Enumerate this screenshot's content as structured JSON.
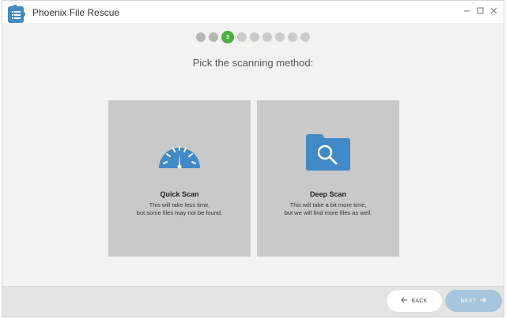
{
  "window": {
    "title": "Phoenix File Rescue",
    "controls": [
      "minimize-icon",
      "maximize-icon",
      "close-icon"
    ]
  },
  "wizard": {
    "steps_total": 9,
    "current_step": 3,
    "current_step_label": "3"
  },
  "main": {
    "heading": "Pick the scanning method:",
    "options": [
      {
        "id": "quick",
        "icon": "speedometer-icon",
        "title": "Quick Scan",
        "desc_line1": "This will take less time,",
        "desc_line2": "but some files may not be found."
      },
      {
        "id": "deep",
        "icon": "folder-search-icon",
        "title": "Deep Scan",
        "desc_line1": "This will take a bit more time,",
        "desc_line2": "but we will find more files as well."
      }
    ]
  },
  "footer": {
    "back_label": "BACK",
    "next_label": "NEXT"
  },
  "colors": {
    "accent_blue": "#3f8ac7",
    "step_active": "#4caf3f",
    "next_disabled": "#a7c6dd"
  }
}
